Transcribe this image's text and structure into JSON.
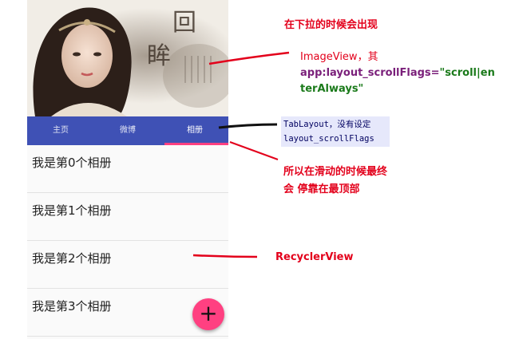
{
  "tabs": [
    "主页",
    "微博",
    "相册"
  ],
  "active_tab": 2,
  "list_items": [
    "我是第0个相册",
    "我是第1个相册",
    "我是第2个相册",
    "我是第3个相册"
  ],
  "fab": {
    "label": "+"
  },
  "header_image": {
    "text": "回眸"
  },
  "annotations": {
    "pull_down": "在下拉的时候会出现",
    "imageview": {
      "line1": "ImageView，其",
      "attr": "app:layout_scrollFlags=",
      "value_part1": "\"scroll|en",
      "value_part2": "terAlways\""
    },
    "tablayout": {
      "line1": "TabLayout，没有设定",
      "line2": "layout_scrollFlags"
    },
    "stop_top": {
      "line1": "所以在滑动的时候最终",
      "line2": "会 停靠在最顶部"
    },
    "recyclerview": "RecyclerView"
  },
  "colors": {
    "primary": "#3f51b5",
    "accent": "#ff4081",
    "annotation_red": "#e3001b",
    "list_background": "#fafafa"
  }
}
